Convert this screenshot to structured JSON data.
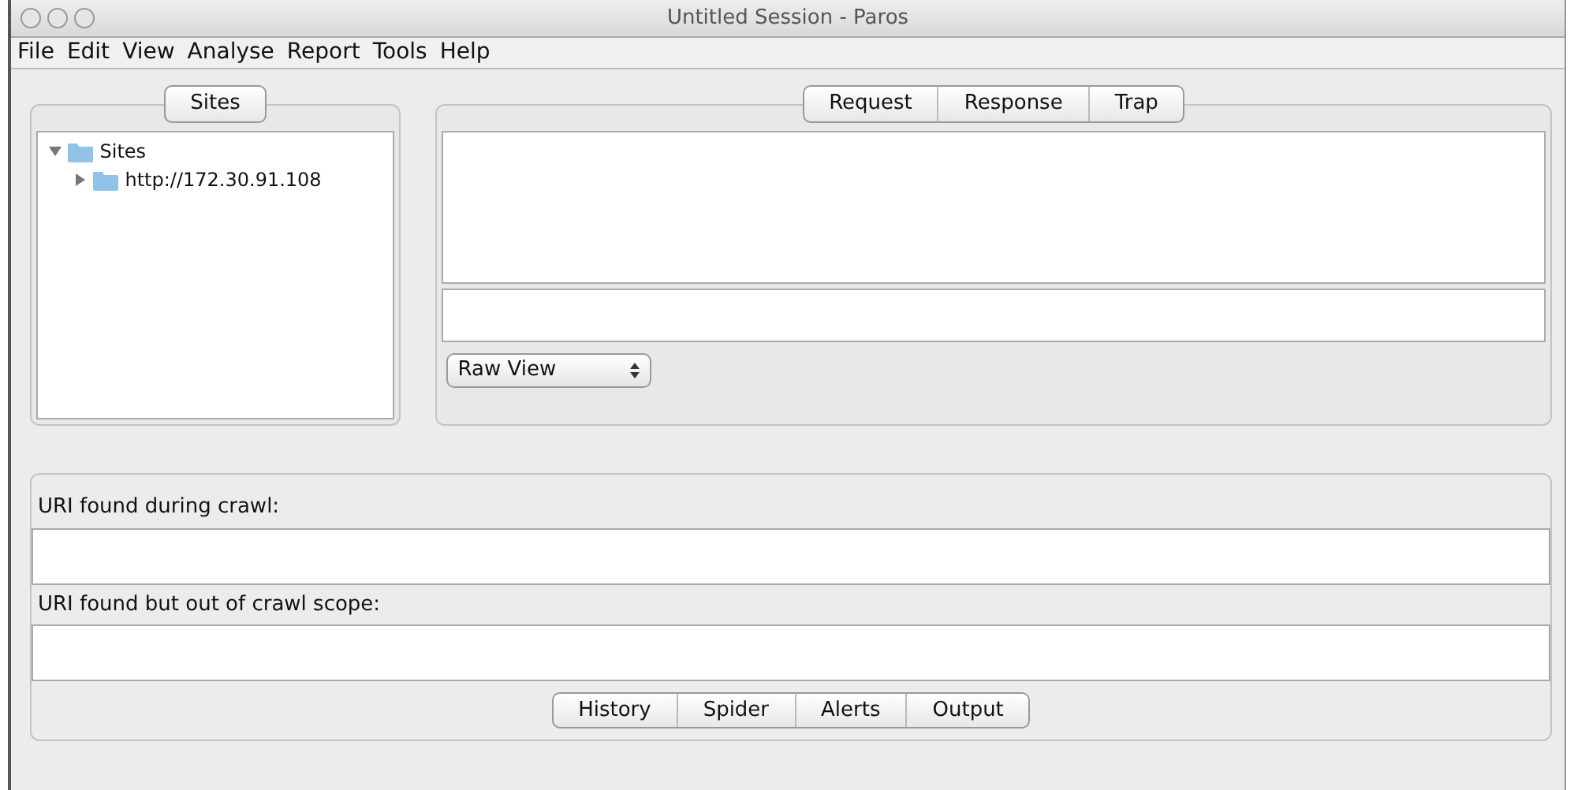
{
  "window": {
    "title": "Untitled Session - Paros"
  },
  "menu": [
    "File",
    "Edit",
    "View",
    "Analyse",
    "Report",
    "Tools",
    "Help"
  ],
  "sites_panel": {
    "tabs": [
      {
        "label": "Sites",
        "selected": false
      }
    ],
    "tree": [
      {
        "label": "Sites",
        "expanded": true,
        "children": [
          {
            "label": "http://172.30.91.108",
            "expanded": false
          }
        ]
      }
    ]
  },
  "request_panel": {
    "tabs": [
      {
        "label": "Request",
        "selected": false
      },
      {
        "label": "Response",
        "selected": false
      },
      {
        "label": "Trap",
        "selected": false
      }
    ],
    "view_select": {
      "value": "Raw View"
    }
  },
  "spider_panel": {
    "fields": [
      {
        "label": "URI found during crawl:"
      },
      {
        "label": "URI found but out of crawl scope:"
      }
    ]
  },
  "bottom_tabs": [
    {
      "label": "History",
      "selected": false
    },
    {
      "label": "Spider",
      "selected": false
    },
    {
      "label": "Alerts",
      "selected": false
    },
    {
      "label": "Output",
      "selected": false
    }
  ]
}
